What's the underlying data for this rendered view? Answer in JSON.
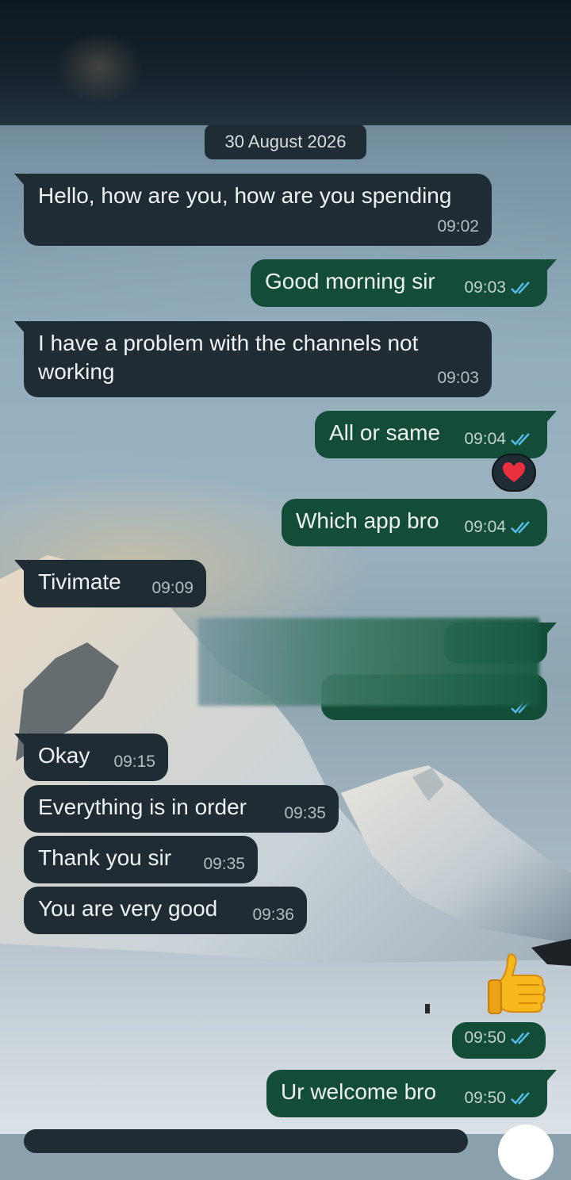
{
  "chat": {
    "date_chip": "30 August 2026",
    "messages": [
      {
        "direction": "incoming",
        "text": "Hello, how are you, how are you spending",
        "time": "09:02"
      },
      {
        "direction": "outgoing",
        "text": "Good morning sir",
        "time": "09:03",
        "status": "read"
      },
      {
        "direction": "incoming",
        "text": "I have a problem with the channels not working",
        "line1": "I have a problem with the channels not",
        "line2": "working",
        "time": "09:03"
      },
      {
        "direction": "outgoing",
        "text": "All or same",
        "time": "09:04",
        "status": "read",
        "reaction": "red-heart"
      },
      {
        "direction": "outgoing",
        "text": "Which app bro",
        "time": "09:04",
        "status": "read"
      },
      {
        "direction": "incoming",
        "text": "Tivimate",
        "time": "09:09"
      },
      {
        "direction": "outgoing",
        "text": "",
        "time": "",
        "status": "read",
        "redacted": true
      },
      {
        "direction": "incoming",
        "text": "Okay",
        "time": "09:15"
      },
      {
        "direction": "incoming",
        "text": "Everything is in order",
        "time": "09:35"
      },
      {
        "direction": "incoming",
        "text": "Thank you sir",
        "time": "09:35"
      },
      {
        "direction": "incoming",
        "text": "You are very good",
        "time": "09:36"
      },
      {
        "direction": "outgoing",
        "sticker": "thumbs-up",
        "time": "09:50",
        "status": "read"
      },
      {
        "direction": "outgoing",
        "text": "Ur welcome bro",
        "time": "09:50",
        "status": "read"
      }
    ]
  },
  "colors": {
    "incoming_bubble": "#1f2c33",
    "outgoing_bubble": "#144d37",
    "read_ticks": "#53bdeb"
  }
}
